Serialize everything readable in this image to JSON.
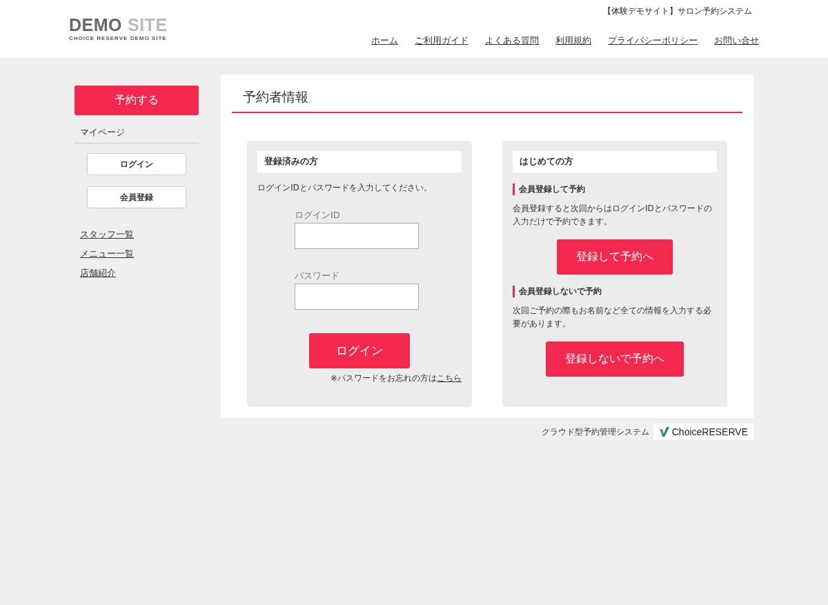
{
  "header": {
    "logo_primary": "DEMO",
    "logo_secondary": "SITE",
    "logo_tagline": "CHOICE RESERVE DEMO SITE",
    "site_title": "【体験デモサイト】サロン予約システム",
    "nav": [
      "ホーム",
      "ご利用ガイド",
      "よくある質問",
      "利用規約",
      "プライバシーポリシー",
      "お問い合せ"
    ]
  },
  "sidebar": {
    "reserve_button": "予約する",
    "mypage_label": "マイページ",
    "mypage_buttons": [
      "ログイン",
      "会員登録"
    ],
    "links": [
      "スタッフ一覧",
      "メニュー一覧",
      "店舗紹介"
    ]
  },
  "main": {
    "title": "予約者情報",
    "login_panel": {
      "heading": "登録済みの方",
      "instruction": "ログインIDとパスワードを入力してください。",
      "fields": [
        {
          "label": "ログインID"
        },
        {
          "label": "パスワード"
        }
      ],
      "button": "ログイン",
      "forgot_text": "※パスワードをお忘れの方は",
      "forgot_link": "こちら"
    },
    "register_panel": {
      "heading": "はじめての方",
      "sections": [
        {
          "heading": "会員登録して予約",
          "text": "会員登録すると次回からはログインIDとパスワードの入力だけで予約できます。",
          "button": "登録して予約へ"
        },
        {
          "heading": "会員登録しないで予約",
          "text": "次回ご予約の際もお名前など全ての情報を入力する必要があります。",
          "button": "登録しないで予約へ"
        }
      ]
    }
  },
  "footer": {
    "caption": "クラウド型予約管理システム",
    "badge": "ChoiceRESERVE"
  }
}
